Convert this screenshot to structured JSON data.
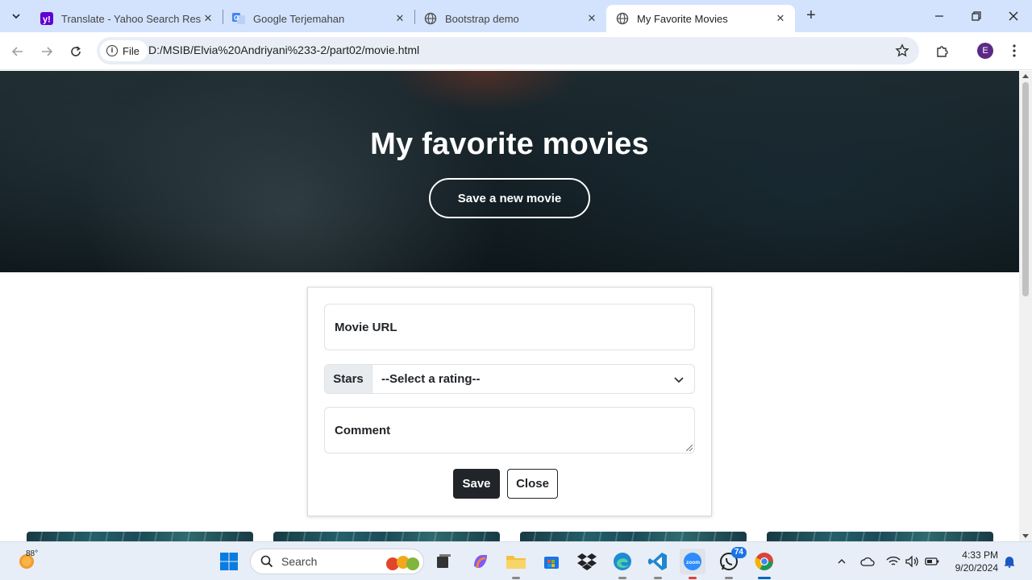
{
  "browser": {
    "tabs": [
      {
        "title": "Translate - Yahoo Search Results",
        "icon": "yahoo-icon",
        "active": false
      },
      {
        "title": "Google Terjemahan",
        "icon": "google-translate-icon",
        "active": false
      },
      {
        "title": "Bootstrap demo",
        "icon": "globe-icon",
        "active": false
      },
      {
        "title": "My Favorite Movies",
        "icon": "globe-icon",
        "active": true
      }
    ],
    "address_chip": "File",
    "url": "D:/MSIB/Elvia%20Andriyani%233-2/part02/movie.html",
    "profile_initial": "E"
  },
  "page": {
    "hero_title": "My favorite movies",
    "hero_button": "Save a new movie",
    "form": {
      "url_label": "Movie URL",
      "stars_label": "Stars",
      "stars_selected": "--Select a rating--",
      "comment_label": "Comment",
      "save_label": "Save",
      "close_label": "Close"
    },
    "thumbnail_count": 4
  },
  "taskbar": {
    "weather_temp": "88°",
    "search_placeholder": "Search",
    "whatsapp_badge": "74",
    "time": "4:33 PM",
    "date": "9/20/2024"
  },
  "colors": {
    "tabstrip": "#d3e3fd",
    "primary_dark": "#212529",
    "taskbar": "#e8eef7",
    "accent": "#0067c0"
  }
}
